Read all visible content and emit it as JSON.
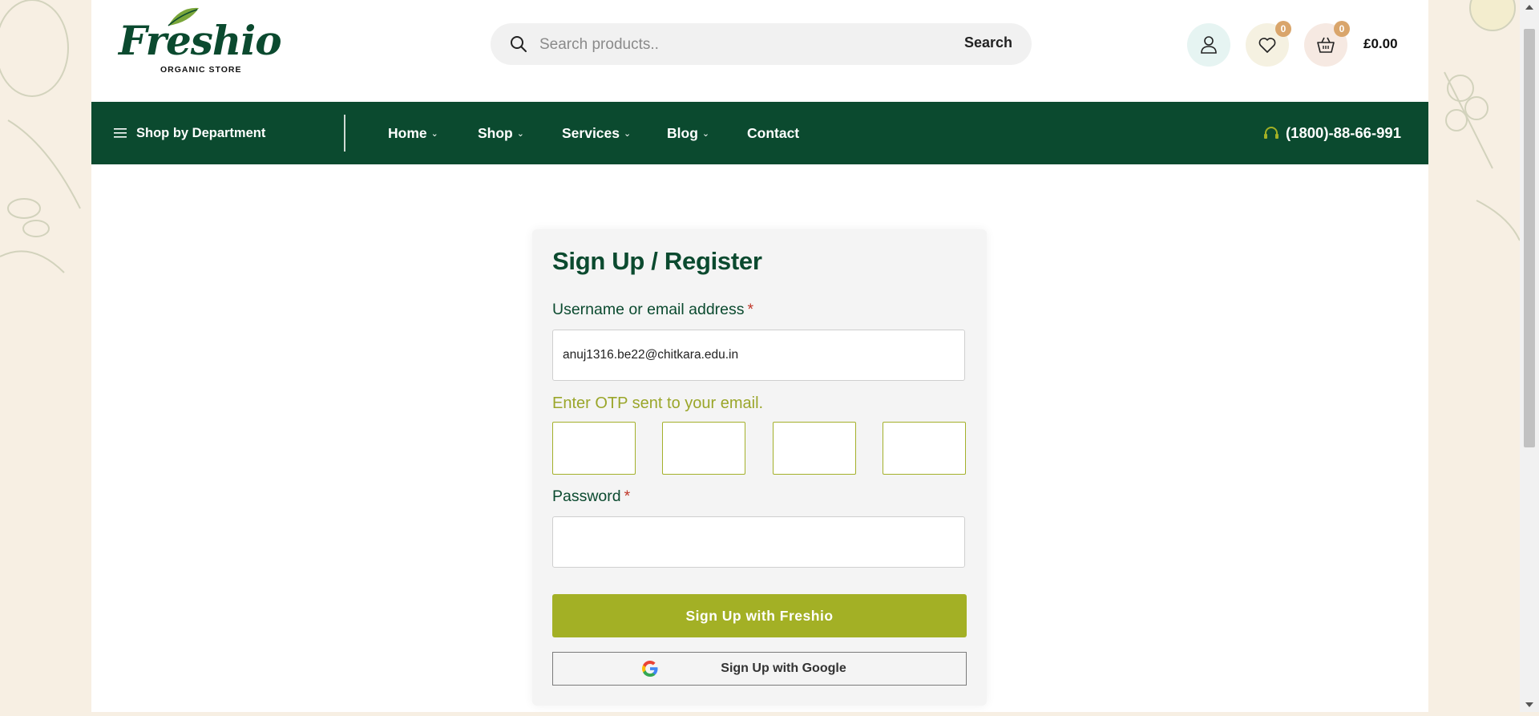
{
  "header": {
    "logo": {
      "name": "Freshio",
      "tagline": "ORGANIC STORE"
    },
    "search": {
      "placeholder": "Search products..",
      "button_label": "Search"
    },
    "wishlist_count": "0",
    "cart_count": "0",
    "cart_total": "£0.00"
  },
  "nav": {
    "department_label": "Shop by Department",
    "items": [
      {
        "label": "Home",
        "has_dropdown": true
      },
      {
        "label": "Shop",
        "has_dropdown": true
      },
      {
        "label": "Services",
        "has_dropdown": true
      },
      {
        "label": "Blog",
        "has_dropdown": true
      },
      {
        "label": "Contact",
        "has_dropdown": false
      }
    ],
    "phone": "(1800)-88-66-991"
  },
  "form": {
    "title": "Sign Up / Register",
    "username_label": "Username or email address",
    "required_mark": "*",
    "username_value": "anuj1316.be22@chitkara.edu.in",
    "otp_label": "Enter OTP sent to your email.",
    "password_label": "Password",
    "submit_label": "Sign Up with Freshio",
    "google_label": "Sign Up with Google"
  },
  "colors": {
    "brand_green": "#0b4a2f",
    "accent_olive": "#a3b025",
    "required_red": "#c0392b",
    "badge": "#d9a56b"
  },
  "icons": [
    "search-icon",
    "user-icon",
    "heart-icon",
    "basket-icon",
    "menu-icon",
    "chevron-down-icon",
    "headset-icon",
    "google-icon"
  ]
}
